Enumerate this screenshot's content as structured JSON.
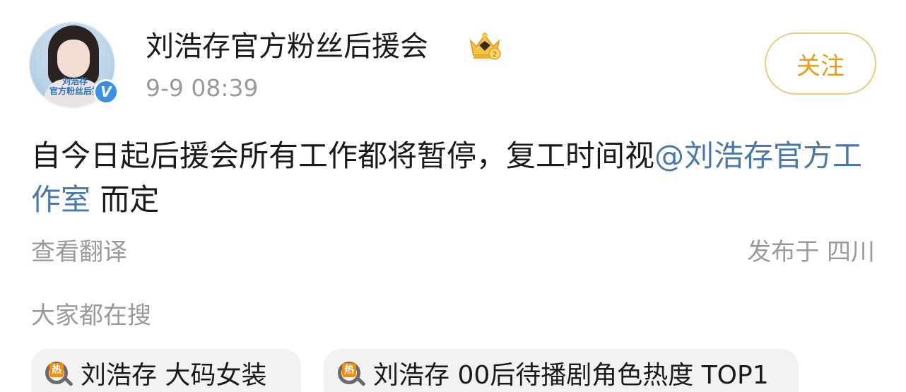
{
  "post": {
    "username": "刘浩存官方粉丝后援会",
    "timestamp": "9-9 08:39",
    "follow_label": "关注",
    "avatar_caption": "刘浩存\n官方粉丝后援",
    "verified_badge": "V",
    "text_before": "自今日起后援会所有工作都将暂停，复工时间视",
    "mention": "@刘浩存官方工作室",
    "text_after": " 而定",
    "translate_label": "查看翻译",
    "location": "发布于 四川"
  },
  "trending": {
    "heading": "大家都在搜",
    "hot_tag": "热",
    "items": [
      {
        "label": "刘浩存 大码女装"
      },
      {
        "label": "刘浩存 00后待播剧角色热度 TOP1"
      }
    ]
  },
  "colors": {
    "accent_orange": "#f09a16",
    "mention_blue": "#4a78a8",
    "verified_blue": "#3b8fe4",
    "muted_gray": "#9a9a9a"
  },
  "icons": [
    "crown-icon",
    "verified-icon",
    "search-hot-icon"
  ]
}
